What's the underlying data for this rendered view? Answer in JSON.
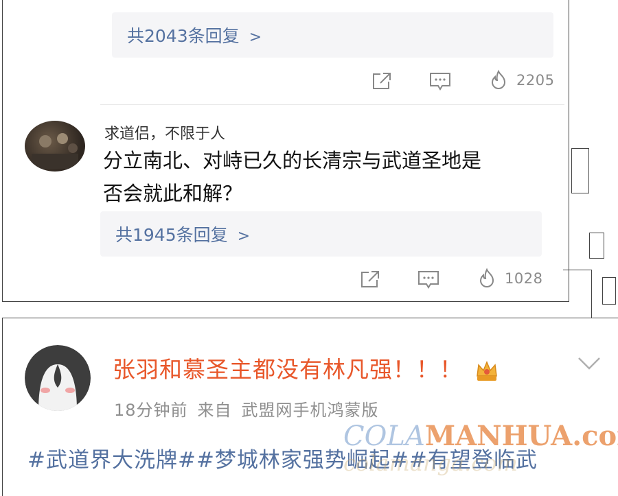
{
  "thread1": {
    "reply_summary": "共2043条回复",
    "like_count": "2205"
  },
  "thread2": {
    "username": "求道侣，不限于人",
    "comment_line1": "分立南北、对峙已久的长清宗与武道圣地是",
    "comment_line2": "否会就此和解？",
    "reply_summary": "共1945条回复",
    "like_count": "1028"
  },
  "post": {
    "username": "张羽和慕圣主都没有林凡强！！！",
    "time": "18分钟前",
    "from_label": "来自",
    "client": "武盟网手机鸿蒙版",
    "hashtags": "#武道界大洗牌##梦城林家强势崛起##有望登临武"
  },
  "icons": {
    "chevron": "chevron-right-icon",
    "share": "share-icon",
    "comment": "comment-icon",
    "like": "flame-like-icon",
    "badge": "crown-badge-icon",
    "expand": "chevron-down-icon"
  },
  "colors": {
    "link_blue": "#5471a0",
    "username_orange": "#e8572a",
    "meta_gray": "#8f8f8f"
  },
  "watermark": {
    "part1": "COLA",
    "part2": "MANHUA",
    "part3": ".com",
    "part4": "colamanga.com"
  }
}
